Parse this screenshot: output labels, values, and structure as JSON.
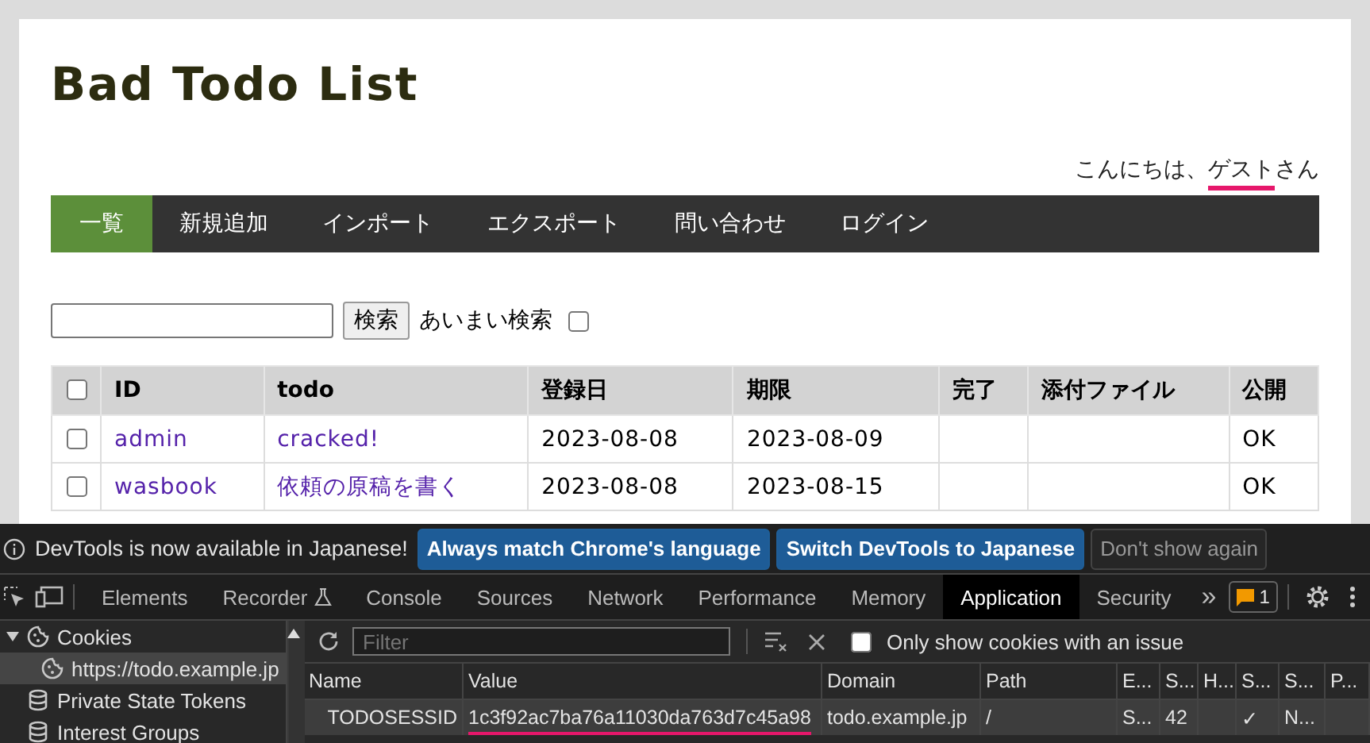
{
  "page": {
    "title": "Bad Todo List",
    "greeting": {
      "before": "こんにちは、",
      "name": "ゲスト",
      "after": "さん",
      "underlined": true
    },
    "nav": [
      {
        "label": "一覧",
        "selected": true
      },
      {
        "label": "新規追加",
        "selected": false
      },
      {
        "label": "インポート",
        "selected": false
      },
      {
        "label": "エクスポート",
        "selected": false
      },
      {
        "label": "問い合わせ",
        "selected": false
      },
      {
        "label": "ログイン",
        "selected": false
      }
    ],
    "search": {
      "button": "検索",
      "fuzzy_label": "あいまい検索",
      "fuzzy_checked": false
    },
    "table": {
      "columns": [
        "ID",
        "todo",
        "登録日",
        "期限",
        "完了",
        "添付ファイル",
        "公開"
      ],
      "select_all_checked": false,
      "rows": [
        {
          "checked": false,
          "id": "admin",
          "todo": "cracked!",
          "created": "2023-08-08",
          "due": "2023-08-09",
          "done": "",
          "attachment": "",
          "public": "OK"
        },
        {
          "checked": false,
          "id": "wasbook",
          "todo": "依頼の原稿を書く",
          "created": "2023-08-08",
          "due": "2023-08-15",
          "done": "",
          "attachment": "",
          "public": "OK"
        }
      ]
    }
  },
  "devtools": {
    "infobar": {
      "message": "DevTools is now available in Japanese!",
      "buttons": [
        {
          "label": "Always match Chrome's language",
          "kind": "primary"
        },
        {
          "label": "Switch DevTools to Japanese",
          "kind": "primary"
        },
        {
          "label": "Don't show again",
          "kind": "secondary"
        }
      ]
    },
    "tabs": [
      {
        "label": "Elements",
        "selected": false
      },
      {
        "label": "Recorder",
        "selected": false
      },
      {
        "label": "Console",
        "selected": false
      },
      {
        "label": "Sources",
        "selected": false
      },
      {
        "label": "Network",
        "selected": false
      },
      {
        "label": "Performance",
        "selected": false
      },
      {
        "label": "Memory",
        "selected": false
      },
      {
        "label": "Application",
        "selected": true
      },
      {
        "label": "Security",
        "selected": false
      }
    ],
    "more": "»",
    "issues_badge": "1",
    "sidebar": [
      {
        "label": "Cookies",
        "kind": "cookie",
        "expanded": true,
        "selected": false,
        "children": [
          {
            "label": "https://todo.example.jp",
            "kind": "cookie",
            "selected": true
          }
        ]
      },
      {
        "label": "Private State Tokens",
        "kind": "database",
        "selected": false
      },
      {
        "label": "Interest Groups",
        "kind": "database",
        "selected": false
      }
    ],
    "filter": {
      "placeholder": "Filter"
    },
    "issue_only": {
      "label": "Only show cookies with an issue",
      "checked": false
    },
    "cookies": {
      "columns": [
        "Name",
        "Value",
        "Domain",
        "Path",
        "E...",
        "S...",
        "H...",
        "S...",
        "S...",
        "P..."
      ],
      "rows": [
        {
          "selected": true,
          "cells": [
            "TODOSESSID",
            "1c3f92ac7ba76a11030da763d7c45a98",
            "todo.example.jp",
            "/",
            "S...",
            "42",
            "",
            "✓",
            "N...",
            ""
          ],
          "value_underlined": true
        }
      ]
    }
  }
}
